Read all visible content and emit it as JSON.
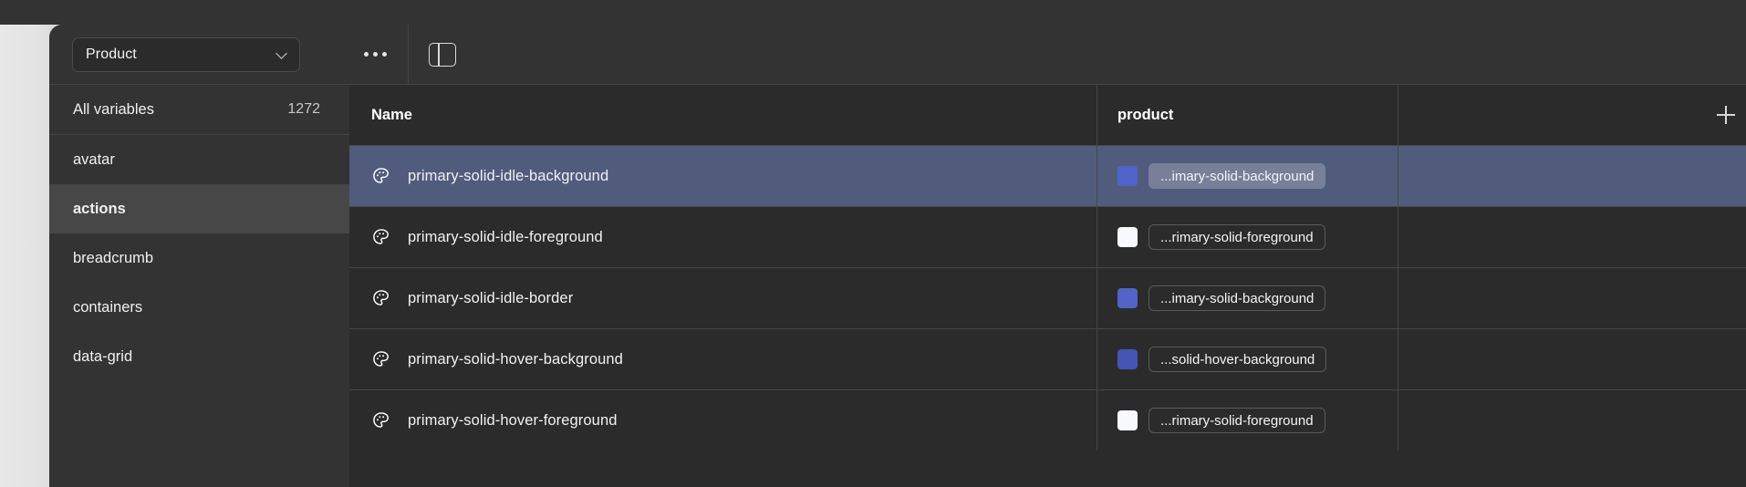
{
  "window": {
    "title_band": ""
  },
  "sidebar": {
    "collection_select": {
      "label": "Product",
      "chevron_icon": "chevron-down-icon"
    },
    "items": [
      {
        "label": "All variables",
        "count": "1272",
        "active": false
      },
      {
        "label": "avatar",
        "count": "",
        "active": false
      },
      {
        "label": "actions",
        "count": "",
        "active": true
      },
      {
        "label": "breadcrumb",
        "count": "",
        "active": false
      },
      {
        "label": "containers",
        "count": "",
        "active": false
      },
      {
        "label": "data-grid",
        "count": "",
        "active": false
      }
    ]
  },
  "toolbar": {
    "more_icon": "ellipsis-horizontal-icon",
    "panel_toggle_icon": "sidebar-toggle-icon"
  },
  "table": {
    "columns": [
      {
        "key": "name",
        "label": "Name"
      },
      {
        "key": "product",
        "label": "product"
      },
      {
        "key": "add",
        "label": ""
      }
    ],
    "add_column_icon": "plus-icon",
    "rows": [
      {
        "icon": "color-palette-icon",
        "name": "primary-solid-idle-background",
        "swatch": "#5264c8",
        "chip": "...imary-solid-background",
        "selected": true
      },
      {
        "icon": "color-palette-icon",
        "name": "primary-solid-idle-foreground",
        "swatch": "#f8f9fc",
        "chip": "...rimary-solid-foreground",
        "selected": false
      },
      {
        "icon": "color-palette-icon",
        "name": "primary-solid-idle-border",
        "swatch": "#5264c8",
        "chip": "...imary-solid-background",
        "selected": false
      },
      {
        "icon": "color-palette-icon",
        "name": "primary-solid-hover-background",
        "swatch": "#4455b4",
        "chip": "...solid-hover-background",
        "selected": false
      },
      {
        "icon": "color-palette-icon",
        "name": "primary-solid-hover-foreground",
        "swatch": "#f8f9fc",
        "chip": "...rimary-solid-foreground",
        "selected": false
      }
    ]
  },
  "colors": {
    "selected_row": "#515c7d",
    "modal_bg": "#2b2b2b",
    "sidebar_bg": "#333333",
    "active_nav": "#474747",
    "divider": "#464646"
  }
}
